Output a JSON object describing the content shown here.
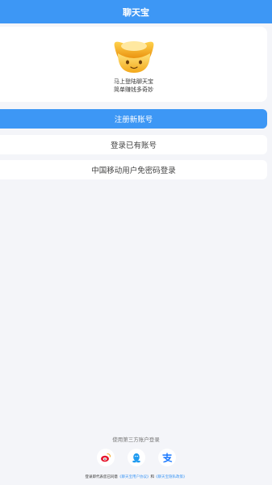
{
  "header": {
    "title": "聊天宝"
  },
  "hero": {
    "icon": "gold-ingot-icon",
    "line1": "马上登陆聊天宝",
    "line2": "简单赚钱多奇妙"
  },
  "buttons": {
    "register": "注册新账号",
    "login": "登录已有账号",
    "mobile_login": "中国移动用户免密码登录"
  },
  "third_party": {
    "title": "使用第三方账户登录",
    "icons": [
      "weibo-icon",
      "qq-icon",
      "alipay-icon"
    ]
  },
  "agreement": {
    "prefix": "登录即代表您已同意",
    "user_agreement": "《聊天宝用户协议》",
    "and": "和",
    "privacy_policy": "《聊天宝隐私政策》"
  },
  "colors": {
    "accent": "#3d97f5",
    "background": "#f4f5f9"
  }
}
